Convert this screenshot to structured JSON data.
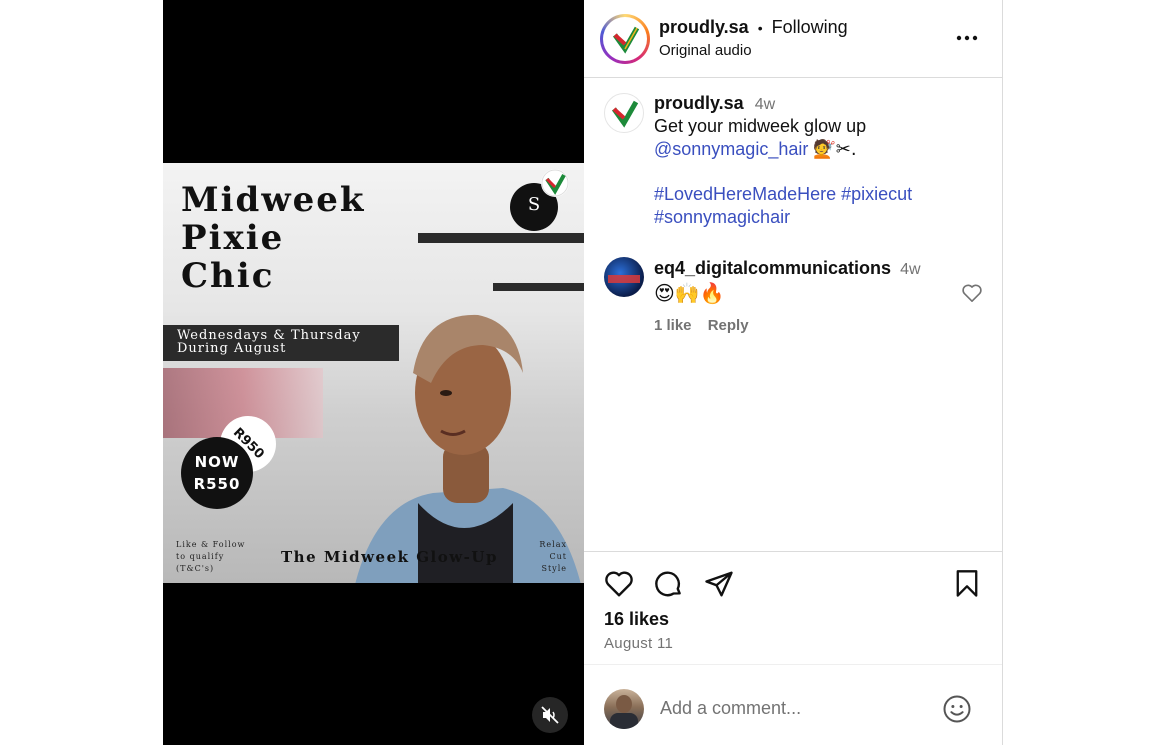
{
  "post": {
    "poster": {
      "title": "Midweek\nPixie\nChic",
      "band": "Wednesdays & Thursday\nDuring August",
      "logo_letter": "S",
      "old_price": "R950",
      "new_price": "NOW\nR550",
      "follow_note": "Like & Follow\nto qualify\n(T&C's)",
      "glow_text": "The Midweek Glow-Up",
      "services": "Relax\nCut\nStyle"
    },
    "mute_icon": "speaker-muted-icon"
  },
  "header": {
    "username": "proudly.sa",
    "separator": "•",
    "follow_status": "Following",
    "audio": "Original audio",
    "more_icon": "more-horizontal-icon"
  },
  "caption": {
    "username": "proudly.sa",
    "time": "4w",
    "line1": "Get your midweek glow up",
    "mention": "@sonnymagic_hair",
    "emojis": "💇✂.",
    "hashtag1": "#LovedHereMadeHere",
    "hashtag2": "#pixiecut",
    "hashtag3": "#sonnymagichair"
  },
  "comment": {
    "username": "eq4_digitalcommunications",
    "time": "4w",
    "text": "😍🙌🔥",
    "likes": "1 like",
    "reply": "Reply"
  },
  "actions": {
    "likes": "16 likes",
    "date": "August 11"
  },
  "composer": {
    "placeholder": "Add a comment..."
  },
  "colors": {
    "link": "#3a4fbf",
    "border": "#dbdbdb",
    "muted": "#737373"
  }
}
